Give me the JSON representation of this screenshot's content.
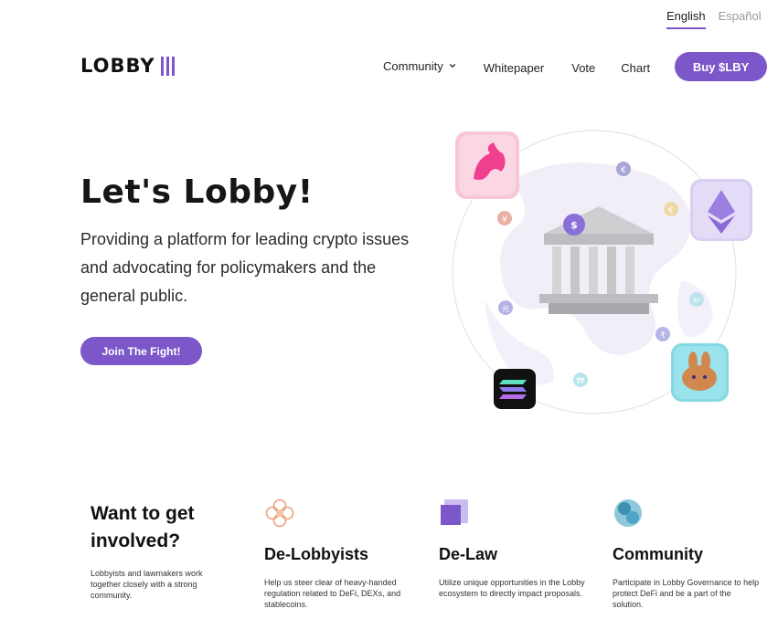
{
  "languages": {
    "english": "English",
    "espanol": "Español"
  },
  "brand": {
    "logo_text": "LOBBY"
  },
  "nav": {
    "community": "Community",
    "whitepaper": "Whitepaper",
    "vote": "Vote",
    "chart": "Chart",
    "buy": "Buy $LBY"
  },
  "hero": {
    "title": "Let's Lobby!",
    "subtitle": "Providing a platform for leading crypto issues and advocating for policymakers and the general public.",
    "cta": "Join The Fight!"
  },
  "illustration": {
    "currency_symbols": [
      "€",
      "¥",
      "€",
      "$",
      "kr",
      "元",
      "₹",
      "₩"
    ]
  },
  "involved": {
    "title": "Want to get involved?",
    "description": "Lobbyists and lawmakers work together closely with a strong community.",
    "features": [
      {
        "title": "De-Lobbyists",
        "description": "Help us steer clear of heavy-handed regulation related to DeFi, DEXs, and stablecoins.",
        "icon": "flower-icon"
      },
      {
        "title": "De-Law",
        "description": "Utilize unique opportunities in the Lobby ecosystem to directly impact proposals.",
        "icon": "stacked-squares-icon"
      },
      {
        "title": "Community",
        "description": "Participate in Lobby Governance to help protect DeFi and be a part of the solution.",
        "icon": "bubbles-icon"
      }
    ]
  },
  "colors": {
    "accent": "#7b57c9"
  }
}
